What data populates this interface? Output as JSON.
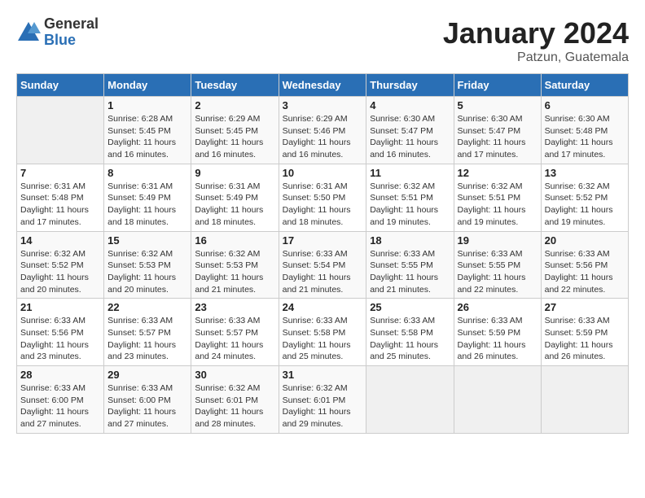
{
  "header": {
    "logo_general": "General",
    "logo_blue": "Blue",
    "month_year": "January 2024",
    "location": "Patzun, Guatemala"
  },
  "weekdays": [
    "Sunday",
    "Monday",
    "Tuesday",
    "Wednesday",
    "Thursday",
    "Friday",
    "Saturday"
  ],
  "weeks": [
    [
      {
        "day": "",
        "info": ""
      },
      {
        "day": "1",
        "info": "Sunrise: 6:28 AM\nSunset: 5:45 PM\nDaylight: 11 hours and 16 minutes."
      },
      {
        "day": "2",
        "info": "Sunrise: 6:29 AM\nSunset: 5:45 PM\nDaylight: 11 hours and 16 minutes."
      },
      {
        "day": "3",
        "info": "Sunrise: 6:29 AM\nSunset: 5:46 PM\nDaylight: 11 hours and 16 minutes."
      },
      {
        "day": "4",
        "info": "Sunrise: 6:30 AM\nSunset: 5:47 PM\nDaylight: 11 hours and 16 minutes."
      },
      {
        "day": "5",
        "info": "Sunrise: 6:30 AM\nSunset: 5:47 PM\nDaylight: 11 hours and 17 minutes."
      },
      {
        "day": "6",
        "info": "Sunrise: 6:30 AM\nSunset: 5:48 PM\nDaylight: 11 hours and 17 minutes."
      }
    ],
    [
      {
        "day": "7",
        "info": "Sunrise: 6:31 AM\nSunset: 5:48 PM\nDaylight: 11 hours and 17 minutes."
      },
      {
        "day": "8",
        "info": "Sunrise: 6:31 AM\nSunset: 5:49 PM\nDaylight: 11 hours and 18 minutes."
      },
      {
        "day": "9",
        "info": "Sunrise: 6:31 AM\nSunset: 5:49 PM\nDaylight: 11 hours and 18 minutes."
      },
      {
        "day": "10",
        "info": "Sunrise: 6:31 AM\nSunset: 5:50 PM\nDaylight: 11 hours and 18 minutes."
      },
      {
        "day": "11",
        "info": "Sunrise: 6:32 AM\nSunset: 5:51 PM\nDaylight: 11 hours and 19 minutes."
      },
      {
        "day": "12",
        "info": "Sunrise: 6:32 AM\nSunset: 5:51 PM\nDaylight: 11 hours and 19 minutes."
      },
      {
        "day": "13",
        "info": "Sunrise: 6:32 AM\nSunset: 5:52 PM\nDaylight: 11 hours and 19 minutes."
      }
    ],
    [
      {
        "day": "14",
        "info": "Sunrise: 6:32 AM\nSunset: 5:52 PM\nDaylight: 11 hours and 20 minutes."
      },
      {
        "day": "15",
        "info": "Sunrise: 6:32 AM\nSunset: 5:53 PM\nDaylight: 11 hours and 20 minutes."
      },
      {
        "day": "16",
        "info": "Sunrise: 6:32 AM\nSunset: 5:53 PM\nDaylight: 11 hours and 21 minutes."
      },
      {
        "day": "17",
        "info": "Sunrise: 6:33 AM\nSunset: 5:54 PM\nDaylight: 11 hours and 21 minutes."
      },
      {
        "day": "18",
        "info": "Sunrise: 6:33 AM\nSunset: 5:55 PM\nDaylight: 11 hours and 21 minutes."
      },
      {
        "day": "19",
        "info": "Sunrise: 6:33 AM\nSunset: 5:55 PM\nDaylight: 11 hours and 22 minutes."
      },
      {
        "day": "20",
        "info": "Sunrise: 6:33 AM\nSunset: 5:56 PM\nDaylight: 11 hours and 22 minutes."
      }
    ],
    [
      {
        "day": "21",
        "info": "Sunrise: 6:33 AM\nSunset: 5:56 PM\nDaylight: 11 hours and 23 minutes."
      },
      {
        "day": "22",
        "info": "Sunrise: 6:33 AM\nSunset: 5:57 PM\nDaylight: 11 hours and 23 minutes."
      },
      {
        "day": "23",
        "info": "Sunrise: 6:33 AM\nSunset: 5:57 PM\nDaylight: 11 hours and 24 minutes."
      },
      {
        "day": "24",
        "info": "Sunrise: 6:33 AM\nSunset: 5:58 PM\nDaylight: 11 hours and 25 minutes."
      },
      {
        "day": "25",
        "info": "Sunrise: 6:33 AM\nSunset: 5:58 PM\nDaylight: 11 hours and 25 minutes."
      },
      {
        "day": "26",
        "info": "Sunrise: 6:33 AM\nSunset: 5:59 PM\nDaylight: 11 hours and 26 minutes."
      },
      {
        "day": "27",
        "info": "Sunrise: 6:33 AM\nSunset: 5:59 PM\nDaylight: 11 hours and 26 minutes."
      }
    ],
    [
      {
        "day": "28",
        "info": "Sunrise: 6:33 AM\nSunset: 6:00 PM\nDaylight: 11 hours and 27 minutes."
      },
      {
        "day": "29",
        "info": "Sunrise: 6:33 AM\nSunset: 6:00 PM\nDaylight: 11 hours and 27 minutes."
      },
      {
        "day": "30",
        "info": "Sunrise: 6:32 AM\nSunset: 6:01 PM\nDaylight: 11 hours and 28 minutes."
      },
      {
        "day": "31",
        "info": "Sunrise: 6:32 AM\nSunset: 6:01 PM\nDaylight: 11 hours and 29 minutes."
      },
      {
        "day": "",
        "info": ""
      },
      {
        "day": "",
        "info": ""
      },
      {
        "day": "",
        "info": ""
      }
    ]
  ]
}
